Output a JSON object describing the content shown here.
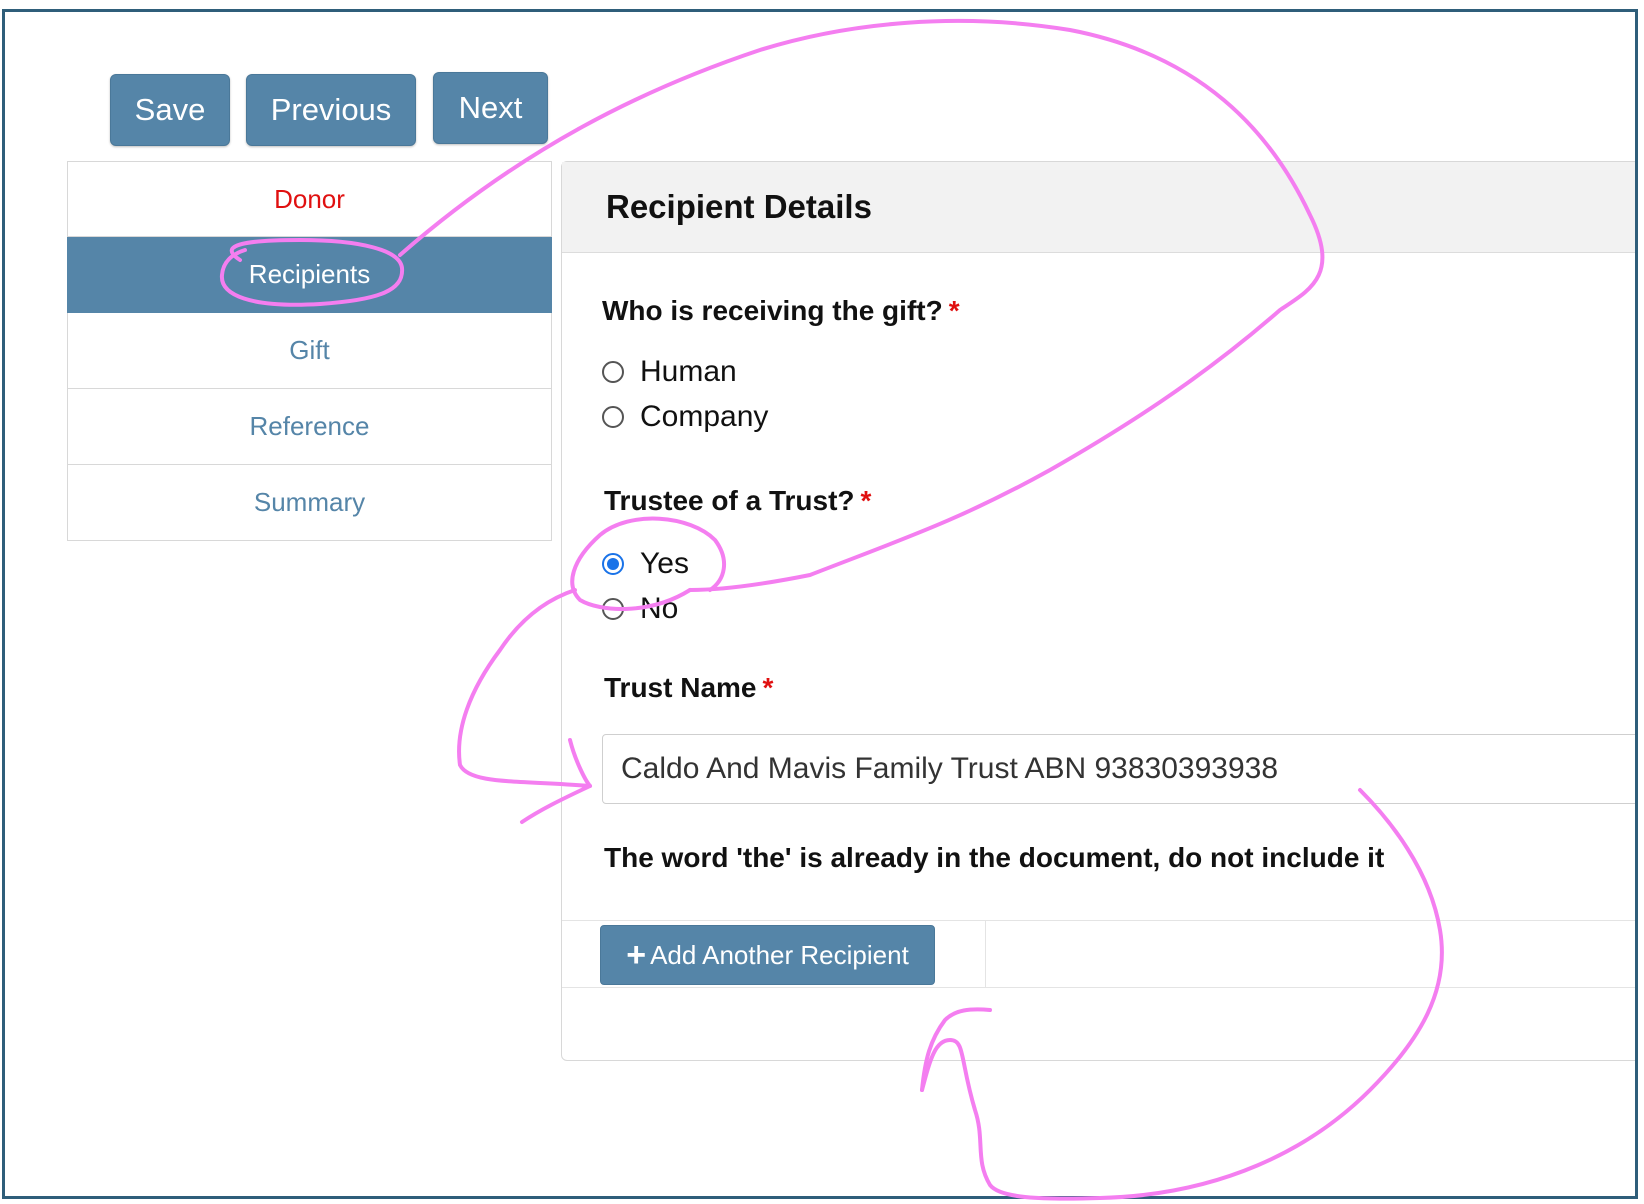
{
  "toolbar": {
    "save_label": "Save",
    "previous_label": "Previous",
    "next_label": "Next"
  },
  "sidebar": {
    "items": [
      {
        "label": "Donor",
        "state": "error"
      },
      {
        "label": "Recipients",
        "state": "active"
      },
      {
        "label": "Gift",
        "state": "normal"
      },
      {
        "label": "Reference",
        "state": "normal"
      },
      {
        "label": "Summary",
        "state": "normal"
      }
    ]
  },
  "panel": {
    "title": "Recipient Details",
    "q1": {
      "label": "Who is receiving the gift?",
      "required_mark": "*",
      "options": [
        {
          "label": "Human",
          "checked": false
        },
        {
          "label": "Company",
          "checked": false
        }
      ]
    },
    "q2": {
      "label": "Trustee of a Trust?",
      "required_mark": "*",
      "options": [
        {
          "label": "Yes",
          "checked": true
        },
        {
          "label": "No",
          "checked": false
        }
      ]
    },
    "trust_name": {
      "label": "Trust Name",
      "required_mark": "*",
      "value": "Caldo And Mavis Family Trust ABN 93830393938"
    },
    "help_text": "The word 'the' is already in the document, do not include it",
    "add_button_label": "Add Another Recipient",
    "add_button_icon": "plus-icon"
  },
  "colors": {
    "primary": "#5585a8",
    "error": "#e01010",
    "radio_checked": "#1a73e8",
    "annotation": "#f47ef0",
    "frame_border": "#2f5e7a"
  }
}
